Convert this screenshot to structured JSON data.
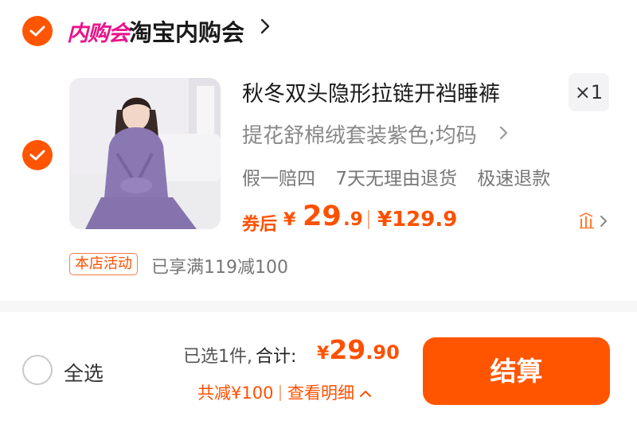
{
  "store": {
    "logo_text": "内购会",
    "name": "淘宝内购会"
  },
  "item": {
    "title": "秋冬双头隐形拉链开裆睡裤",
    "quantity": "×1",
    "sku": "提花舒棉绒套装紫色;均码",
    "services": [
      "假一赔四",
      "7天无理由退货",
      "极速退款"
    ],
    "price": {
      "label": "券后",
      "currency": "¥",
      "integer": "29",
      "decimal": ".9",
      "original": "¥129.9"
    }
  },
  "promotion": {
    "tag": "本店活动",
    "text": "已享满119减100"
  },
  "footer": {
    "select_all_label": "全选",
    "selected_count": "已选1件,",
    "total_label": "合计:",
    "total_currency": "¥",
    "total_integer": "29",
    "total_decimal": ".90",
    "discount_text": "共减¥100",
    "details_link": "查看明细",
    "checkout_label": "结算"
  },
  "colors": {
    "accent": "#ff5500",
    "store_logo": "#e8148a"
  }
}
